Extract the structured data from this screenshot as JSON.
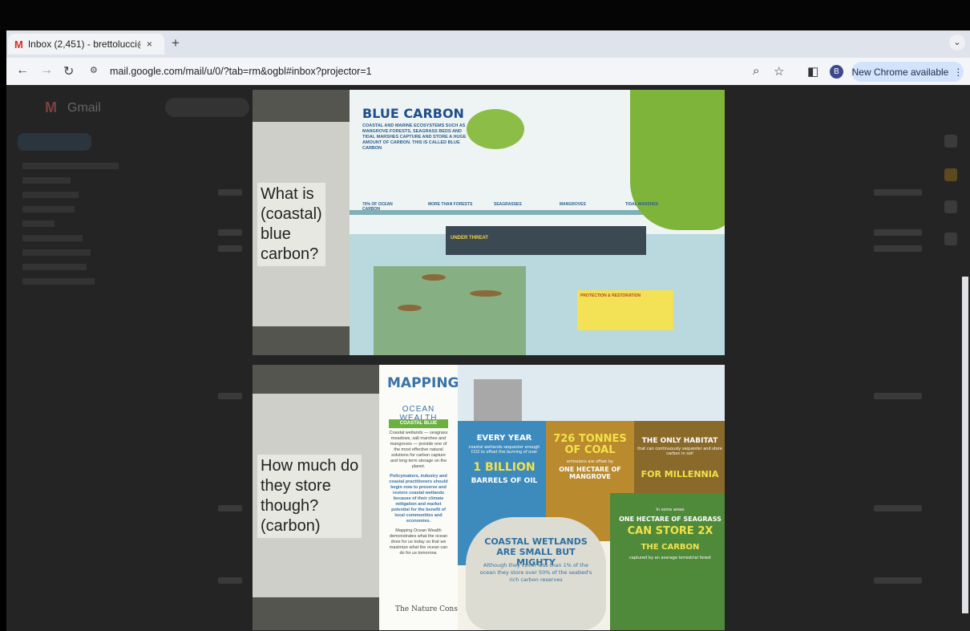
{
  "browser": {
    "tab_title": "Inbox (2,451) - brettolucci@",
    "tab_close": "×",
    "new_tab": "+",
    "tab_menu": "⌄",
    "url": "mail.google.com/mail/u/0/?tab=rm&ogbl#inbox?projector=1",
    "profile_initial": "B",
    "chrome_update_label": "New Chrome available",
    "colors": {
      "chrome_button": "#d3e3fd",
      "toolbar": "#f3f5f9",
      "tabstrip": "#dfe3eb"
    }
  },
  "slide1": {
    "question_lines": [
      "What is",
      "(coastal)",
      "blue",
      "carbon?"
    ],
    "infographic": {
      "title": "BLUE CARBON",
      "intro": "COASTAL AND MARINE ECOSYSTEMS SUCH AS MANGROVE FORESTS, SEAGRASS BEDS AND TIDAL MARSHES CAPTURE AND STORE A HUGE AMOUNT OF CARBON. THIS IS CALLED BLUE CARBON",
      "sections": [
        "70% OF OCEAN CARBON",
        "MORE THAN FORESTS",
        "SEAGRASSES",
        "MANGROVES",
        "TIDAL MARSHES"
      ],
      "threat_label": "UNDER THREAT",
      "protection_label": "PROTECTION & RESTORATION"
    }
  },
  "slide2": {
    "question_lines": [
      "How much do",
      "they store",
      "though?",
      "(carbon)"
    ],
    "mapping": {
      "title_line1": "MAPPING",
      "title_line2": "OCEAN WEALTH",
      "badge": "COASTAL BLUE CARBON",
      "body1": "Coastal wetlands — seagrass meadows, salt marshes and mangroves — provide one of the most effective natural solutions for carbon capture and long term storage on the planet.",
      "body2": "Policymakers, industry and coastal practitioners should begin now to preserve and restore coastal wetlands because of their climate mitigation and market potential for the benefit of local communities and economies.",
      "body3": "Mapping Ocean Wealth demonstrates what the ocean does for us today so that we maximize what the ocean can do for us tomorrow.",
      "org": "The Nature Conservancy"
    },
    "facts": {
      "every_year": "EVERY YEAR",
      "sequester": "coastal wetlands sequester enough CO2 to offset the burning of over",
      "billion": "1 BILLION",
      "barrels": "BARRELS OF OIL",
      "tonnes": "726 TONNES OF COAL",
      "offset": "emissions are offset by",
      "hectare_mangrove": "ONE HECTARE OF MANGROVE",
      "only_habitat": "THE ONLY HABITAT",
      "habitat_desc": "that can continuously sequester and store carbon in soil",
      "millennia": "FOR MILLENNIA",
      "some_areas": "In some areas",
      "seagrass": "ONE HECTARE OF SEAGRASS",
      "store2x": "CAN STORE 2X",
      "the_carbon": "THE CARBON",
      "forest": "captured by an average terrestrial forest",
      "wetlands": "COASTAL WETLANDS ARE SMALL BUT MIGHTY",
      "cover": "Although they cover less than 1% of the ocean they store over 50% of the seabed's rich carbon reserves"
    }
  }
}
